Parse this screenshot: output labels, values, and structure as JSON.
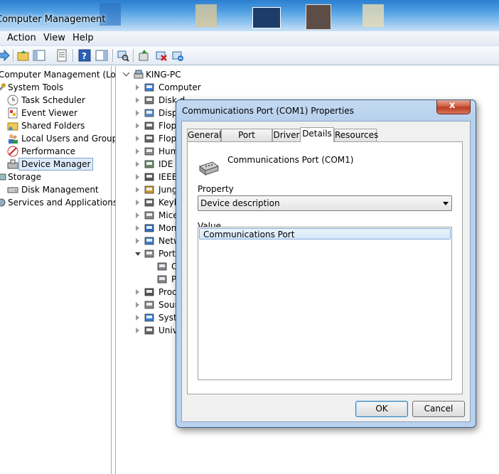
{
  "window": {
    "title": "Computer Management"
  },
  "menu": [
    "Action",
    "View",
    "Help"
  ],
  "left_tree": [
    {
      "label": "Computer Management (Local",
      "icon": "computer-management-icon",
      "level": 0
    },
    {
      "label": "System Tools",
      "icon": "tools-icon",
      "level": 1
    },
    {
      "label": "Task Scheduler",
      "icon": "clock-icon",
      "level": 2
    },
    {
      "label": "Event Viewer",
      "icon": "event-viewer-icon",
      "level": 2
    },
    {
      "label": "Shared Folders",
      "icon": "shared-folder-icon",
      "level": 2
    },
    {
      "label": "Local Users and Groups",
      "icon": "users-icon",
      "level": 2
    },
    {
      "label": "Performance",
      "icon": "performance-icon",
      "level": 2
    },
    {
      "label": "Device Manager",
      "icon": "device-manager-icon",
      "level": 2,
      "selected": true
    },
    {
      "label": "Storage",
      "icon": "storage-icon",
      "level": 1
    },
    {
      "label": "Disk Management",
      "icon": "disk-icon",
      "level": 2
    },
    {
      "label": "Services and Applications",
      "icon": "services-icon",
      "level": 1
    }
  ],
  "device_tree": {
    "root": "KING-PC",
    "items": [
      {
        "label": "Computer",
        "icon": "computer-icon"
      },
      {
        "label": "Disk d",
        "icon": "disk-drive-icon"
      },
      {
        "label": "Disp",
        "icon": "display-icon"
      },
      {
        "label": "Flop",
        "icon": "floppy-icon"
      },
      {
        "label": "Flop",
        "icon": "floppy-icon"
      },
      {
        "label": "Hum",
        "icon": "hid-icon"
      },
      {
        "label": "IDE A",
        "icon": "ide-icon"
      },
      {
        "label": "IEEE",
        "icon": "ieee-icon"
      },
      {
        "label": "Jung",
        "icon": "jungo-icon"
      },
      {
        "label": "Keyb",
        "icon": "keyboard-icon"
      },
      {
        "label": "Mice",
        "icon": "mouse-icon"
      },
      {
        "label": "Mon",
        "icon": "monitor-icon"
      },
      {
        "label": "Netw",
        "icon": "network-icon"
      },
      {
        "label": "Ports",
        "icon": "port-icon",
        "open": true
      },
      {
        "label": "C",
        "icon": "port-icon",
        "child": true
      },
      {
        "label": "P",
        "icon": "port-icon",
        "child": true
      },
      {
        "label": "Proc",
        "icon": "processor-icon"
      },
      {
        "label": "Sour",
        "icon": "sound-icon"
      },
      {
        "label": "Syste",
        "icon": "system-icon"
      },
      {
        "label": "Unive",
        "icon": "usb-icon"
      }
    ]
  },
  "dialog": {
    "title": "Communications Port (COM1) Properties",
    "close_label": "x",
    "tabs": [
      "General",
      "Port Settings",
      "Driver",
      "Details",
      "Resources"
    ],
    "active_tab": "Details",
    "device_name": "Communications Port (COM1)",
    "property_label": "Property",
    "property_value": "Device description",
    "value_label": "Value",
    "value_item": "Communications Port",
    "ok_label": "OK",
    "cancel_label": "Cancel"
  }
}
